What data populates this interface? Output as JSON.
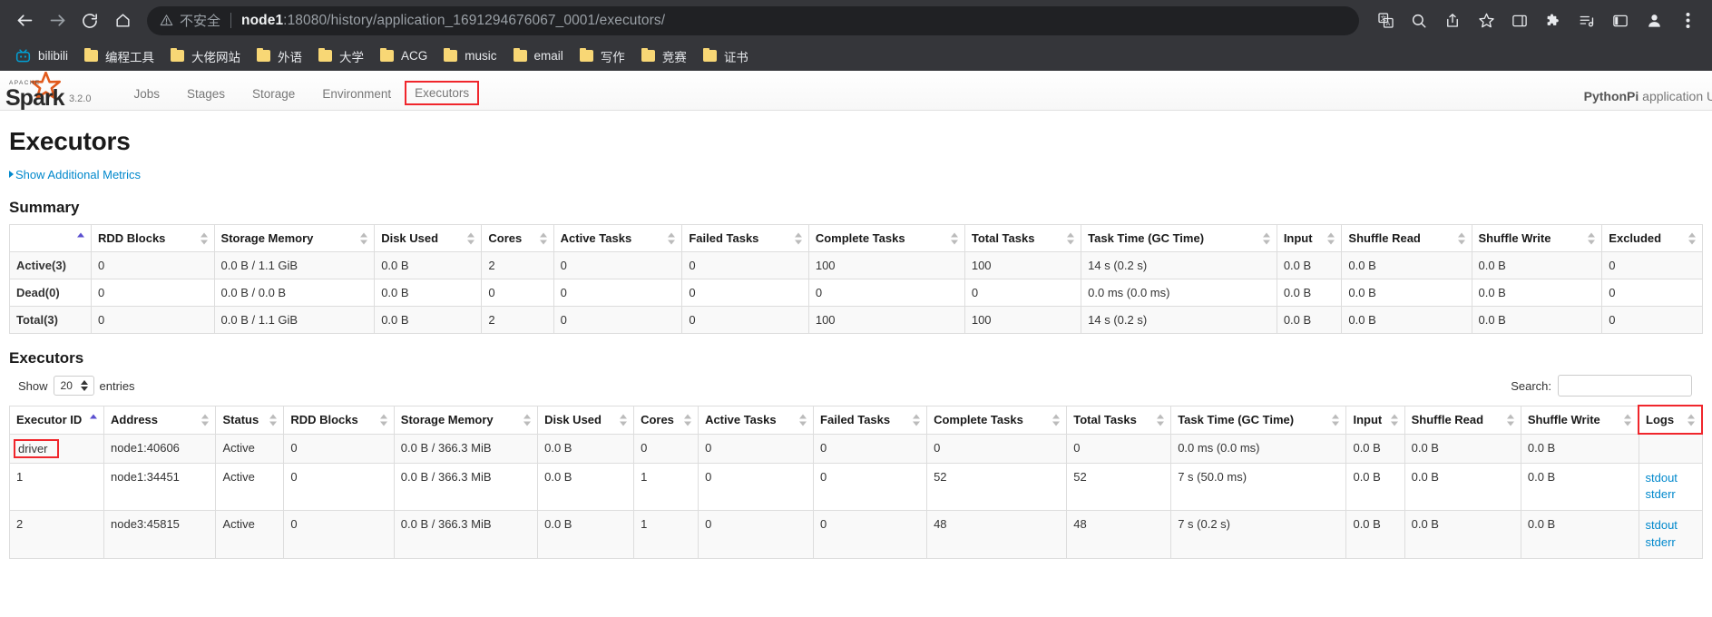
{
  "browser": {
    "nav": {
      "back": "back-arrow",
      "forward": "forward-arrow",
      "reload": "reload",
      "home": "home"
    },
    "omnibox": {
      "insecure_label": "不安全",
      "host": "node1",
      "path": ":18080/history/application_1691294676067_0001/executors/",
      "full_url": "node1:18080/history/application_1691294676067_0001/executors/"
    },
    "toolbar_icons": [
      "translate-icon",
      "search-icon",
      "share-icon",
      "bookmark-star-icon",
      "sidepanel-icon",
      "extensions-puzzle-icon",
      "media-playlist-icon",
      "reading-list-icon",
      "profile-avatar-icon",
      "more-menu-icon"
    ],
    "bookmarks": [
      {
        "label": "bilibili",
        "icon": "bilibili-icon"
      },
      {
        "label": "编程工具",
        "icon": "folder-icon"
      },
      {
        "label": "大佬网站",
        "icon": "folder-icon"
      },
      {
        "label": "外语",
        "icon": "folder-icon"
      },
      {
        "label": "大学",
        "icon": "folder-icon"
      },
      {
        "label": "ACG",
        "icon": "folder-icon"
      },
      {
        "label": "music",
        "icon": "folder-icon"
      },
      {
        "label": "email",
        "icon": "folder-icon"
      },
      {
        "label": "写作",
        "icon": "folder-icon"
      },
      {
        "label": "竞赛",
        "icon": "folder-icon"
      },
      {
        "label": "证书",
        "icon": "folder-icon"
      }
    ]
  },
  "spark": {
    "version": "3.2.0",
    "nav_items": [
      "Jobs",
      "Stages",
      "Storage",
      "Environment",
      "Executors"
    ],
    "active_nav": "Executors",
    "app_title_bold": "PythonPi",
    "app_title_rest": " application UI",
    "page_title": "Executors",
    "show_metrics": "Show Additional Metrics",
    "summary_title": "Summary",
    "executors_title": "Executors",
    "summary": {
      "columns": [
        "",
        "RDD Blocks",
        "Storage Memory",
        "Disk Used",
        "Cores",
        "Active Tasks",
        "Failed Tasks",
        "Complete Tasks",
        "Total Tasks",
        "Task Time (GC Time)",
        "Input",
        "Shuffle Read",
        "Shuffle Write",
        "Excluded"
      ],
      "rows": [
        [
          "Active(3)",
          "0",
          "0.0 B / 1.1 GiB",
          "0.0 B",
          "2",
          "0",
          "0",
          "100",
          "100",
          "14 s (0.2 s)",
          "0.0 B",
          "0.0 B",
          "0.0 B",
          "0"
        ],
        [
          "Dead(0)",
          "0",
          "0.0 B / 0.0 B",
          "0.0 B",
          "0",
          "0",
          "0",
          "0",
          "0",
          "0.0 ms (0.0 ms)",
          "0.0 B",
          "0.0 B",
          "0.0 B",
          "0"
        ],
        [
          "Total(3)",
          "0",
          "0.0 B / 1.1 GiB",
          "0.0 B",
          "2",
          "0",
          "0",
          "100",
          "100",
          "14 s (0.2 s)",
          "0.0 B",
          "0.0 B",
          "0.0 B",
          "0"
        ]
      ]
    },
    "table_controls": {
      "show_label": "Show",
      "entries_label": "entries",
      "page_size": "20",
      "search_label": "Search:",
      "search_value": ""
    },
    "executors": {
      "columns": [
        "Executor ID",
        "Address",
        "Status",
        "RDD Blocks",
        "Storage Memory",
        "Disk Used",
        "Cores",
        "Active Tasks",
        "Failed Tasks",
        "Complete Tasks",
        "Total Tasks",
        "Task Time (GC Time)",
        "Input",
        "Shuffle Read",
        "Shuffle Write",
        "Logs"
      ],
      "rows": [
        {
          "id": "driver",
          "address": "node1:40606",
          "status": "Active",
          "rdd_blocks": "0",
          "storage_memory": "0.0 B / 366.3 MiB",
          "disk_used": "0.0 B",
          "cores": "0",
          "active_tasks": "0",
          "failed_tasks": "0",
          "complete_tasks": "0",
          "total_tasks": "0",
          "task_time": "0.0 ms (0.0 ms)",
          "input": "0.0 B",
          "shuffle_read": "0.0 B",
          "shuffle_write": "0.0 B",
          "logs": []
        },
        {
          "id": "1",
          "address": "node1:34451",
          "status": "Active",
          "rdd_blocks": "0",
          "storage_memory": "0.0 B / 366.3 MiB",
          "disk_used": "0.0 B",
          "cores": "1",
          "active_tasks": "0",
          "failed_tasks": "0",
          "complete_tasks": "52",
          "total_tasks": "52",
          "task_time": "7 s (50.0 ms)",
          "input": "0.0 B",
          "shuffle_read": "0.0 B",
          "shuffle_write": "0.0 B",
          "logs": [
            "stdout",
            "stderr"
          ]
        },
        {
          "id": "2",
          "address": "node3:45815",
          "status": "Active",
          "rdd_blocks": "0",
          "storage_memory": "0.0 B / 366.3 MiB",
          "disk_used": "0.0 B",
          "cores": "1",
          "active_tasks": "0",
          "failed_tasks": "0",
          "complete_tasks": "48",
          "total_tasks": "48",
          "task_time": "7 s (0.2 s)",
          "input": "0.0 B",
          "shuffle_read": "0.0 B",
          "shuffle_write": "0.0 B",
          "logs": [
            "stdout",
            "stderr"
          ]
        }
      ]
    }
  },
  "colors": {
    "chrome_bg": "#35363a",
    "omnibox_bg": "#202124",
    "link": "#0088cc",
    "highlight_red": "#f0262c",
    "spark_orange": "#e25a1c"
  }
}
